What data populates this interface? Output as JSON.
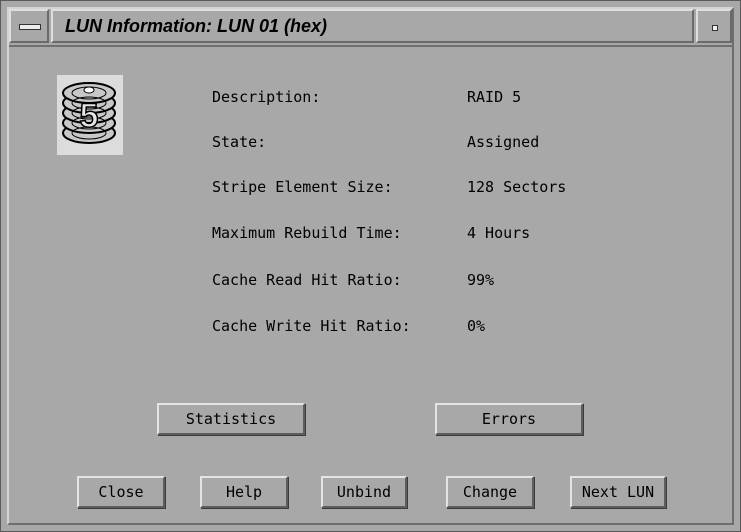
{
  "window": {
    "title": "LUN Information: LUN 01 (hex)"
  },
  "icon": {
    "name": "raid5-disk-stack-icon",
    "label": "5"
  },
  "info": [
    {
      "label": "Description:",
      "value": "RAID 5"
    },
    {
      "label": "State:",
      "value": "Assigned"
    },
    {
      "label": "Stripe Element Size:",
      "value": "128 Sectors"
    },
    {
      "label": "Maximum Rebuild Time:",
      "value": "4 Hours"
    },
    {
      "label": "Cache Read Hit Ratio:",
      "value": "99%"
    },
    {
      "label": "Cache Write Hit Ratio:",
      "value": "0%"
    }
  ],
  "buttons": {
    "statistics": "Statistics",
    "errors": "Errors",
    "close": "Close",
    "help": "Help",
    "unbind": "Unbind",
    "change": "Change",
    "next_lun": "Next LUN"
  },
  "colors": {
    "background": "#a8a8a8",
    "text": "#000000"
  }
}
